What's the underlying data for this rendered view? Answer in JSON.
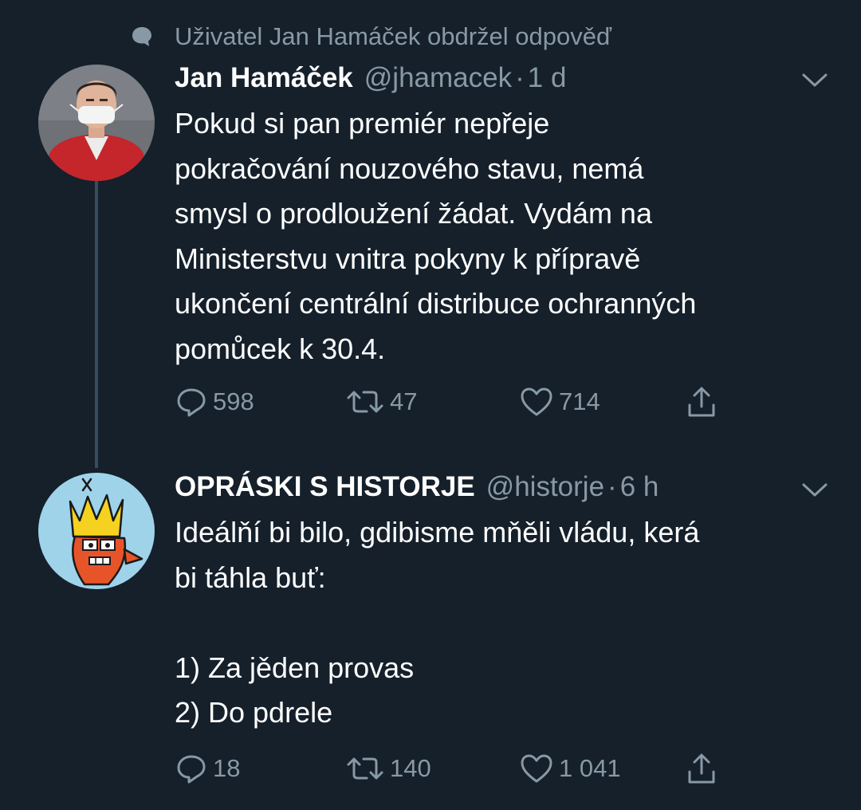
{
  "context_line": "Uživatel Jan Hamáček obdržel odpověď",
  "tweets": [
    {
      "name": "Jan Hamáček",
      "handle": "@jhamacek",
      "separator": "·",
      "time": "1 d",
      "text": "Pokud si pan premiér nepřeje\npokračování nouzového stavu, nemá\nsmysl o prodloužení žádat. Vydám na\nMinisterstvu vnitra pokyny k přípravě\nukončení centrální distribuce ochranných\npomůcek k 30.4.",
      "replies": "598",
      "retweets": "47",
      "likes": "714"
    },
    {
      "name": "OPRÁSKI S HISTORJE",
      "handle": "@historje",
      "separator": "·",
      "time": "6 h",
      "text": "Ideálňí bi bilo, gdibisme mňěli vládu, kerá\nbi táhla buť:\n\n1) Za jěden provas\n2) Do pdrele",
      "replies": "18",
      "retweets": "140",
      "likes": "1 041"
    }
  ],
  "icons": {
    "context": "speech-bubble-icon",
    "menu": "chevron-down-icon",
    "reply": "reply-icon",
    "retweet": "retweet-icon",
    "like": "heart-icon",
    "share": "share-icon"
  },
  "colors": {
    "background": "#15202b",
    "text": "#ffffff",
    "muted": "#8899a6",
    "thread_line": "#3a4b5c"
  }
}
